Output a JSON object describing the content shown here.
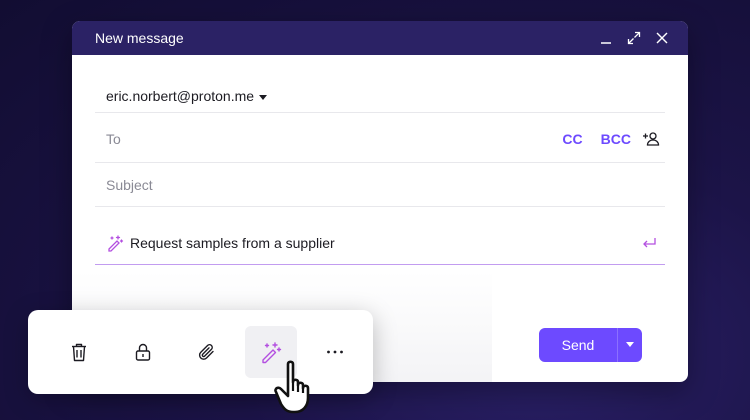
{
  "window": {
    "title": "New message"
  },
  "composer": {
    "from": "eric.norbert@proton.me",
    "to_label": "To",
    "cc_label": "CC",
    "bcc_label": "BCC",
    "subject_label": "Subject",
    "prompt_text": "Request samples from a supplier"
  },
  "send": {
    "label": "Send"
  },
  "toolbar": {
    "items": [
      "trash-icon",
      "lock-icon",
      "paperclip-icon",
      "magic-wand-icon",
      "more-icon"
    ],
    "active": "magic-wand-icon"
  },
  "colors": {
    "accent": "#6d4aff",
    "titlebar": "#2b2265",
    "prompt_underline": "#c29cf0",
    "sparkle": "#b34fe0"
  }
}
